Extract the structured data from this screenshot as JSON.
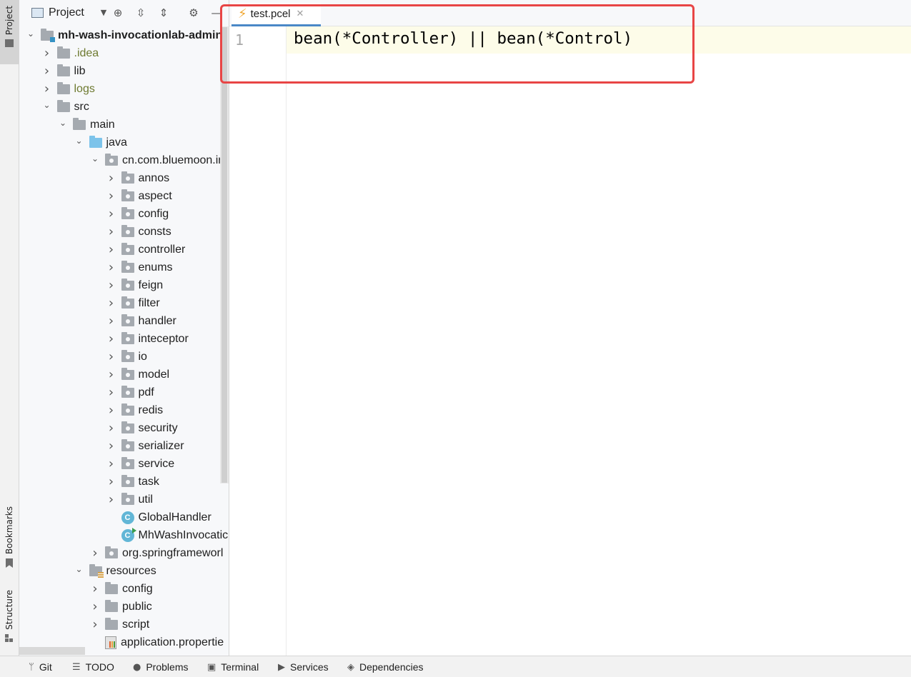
{
  "left_strip": {
    "project_label": "Project",
    "bookmarks_label": "Bookmarks",
    "structure_label": "Structure"
  },
  "project_panel": {
    "title": "Project",
    "tree": [
      {
        "label": "mh-wash-invocationlab-admin",
        "depth": 0,
        "expanded": true,
        "icon": "module-folder-icon",
        "bold": true
      },
      {
        "label": ".idea",
        "depth": 1,
        "expanded": false,
        "icon": "folder-icon",
        "style": "excluded"
      },
      {
        "label": "lib",
        "depth": 1,
        "expanded": false,
        "icon": "folder-icon"
      },
      {
        "label": "logs",
        "depth": 1,
        "expanded": false,
        "icon": "folder-icon",
        "style": "excluded"
      },
      {
        "label": "src",
        "depth": 1,
        "expanded": true,
        "icon": "folder-icon"
      },
      {
        "label": "main",
        "depth": 2,
        "expanded": true,
        "icon": "folder-icon"
      },
      {
        "label": "java",
        "depth": 3,
        "expanded": true,
        "icon": "source-folder-icon"
      },
      {
        "label": "cn.com.bluemoon.in",
        "depth": 4,
        "expanded": true,
        "icon": "package-icon"
      },
      {
        "label": "annos",
        "depth": 5,
        "expanded": false,
        "icon": "package-icon"
      },
      {
        "label": "aspect",
        "depth": 5,
        "expanded": false,
        "icon": "package-icon"
      },
      {
        "label": "config",
        "depth": 5,
        "expanded": false,
        "icon": "package-icon"
      },
      {
        "label": "consts",
        "depth": 5,
        "expanded": false,
        "icon": "package-icon"
      },
      {
        "label": "controller",
        "depth": 5,
        "expanded": false,
        "icon": "package-icon"
      },
      {
        "label": "enums",
        "depth": 5,
        "expanded": false,
        "icon": "package-icon"
      },
      {
        "label": "feign",
        "depth": 5,
        "expanded": false,
        "icon": "package-icon"
      },
      {
        "label": "filter",
        "depth": 5,
        "expanded": false,
        "icon": "package-icon"
      },
      {
        "label": "handler",
        "depth": 5,
        "expanded": false,
        "icon": "package-icon"
      },
      {
        "label": "inteceptor",
        "depth": 5,
        "expanded": false,
        "icon": "package-icon"
      },
      {
        "label": "io",
        "depth": 5,
        "expanded": false,
        "icon": "package-icon"
      },
      {
        "label": "model",
        "depth": 5,
        "expanded": false,
        "icon": "package-icon"
      },
      {
        "label": "pdf",
        "depth": 5,
        "expanded": false,
        "icon": "package-icon"
      },
      {
        "label": "redis",
        "depth": 5,
        "expanded": false,
        "icon": "package-icon"
      },
      {
        "label": "security",
        "depth": 5,
        "expanded": false,
        "icon": "package-icon"
      },
      {
        "label": "serializer",
        "depth": 5,
        "expanded": false,
        "icon": "package-icon"
      },
      {
        "label": "service",
        "depth": 5,
        "expanded": false,
        "icon": "package-icon"
      },
      {
        "label": "task",
        "depth": 5,
        "expanded": false,
        "icon": "package-icon"
      },
      {
        "label": "util",
        "depth": 5,
        "expanded": false,
        "icon": "package-icon"
      },
      {
        "label": "GlobalHandler",
        "depth": 5,
        "expanded": null,
        "icon": "class-icon"
      },
      {
        "label": "MhWashInvocatic",
        "depth": 5,
        "expanded": null,
        "icon": "runnable-class-icon"
      },
      {
        "label": "org.springframeworl",
        "depth": 4,
        "expanded": false,
        "icon": "package-icon"
      },
      {
        "label": "resources",
        "depth": 3,
        "expanded": true,
        "icon": "resources-folder-icon"
      },
      {
        "label": "config",
        "depth": 4,
        "expanded": false,
        "icon": "folder-icon"
      },
      {
        "label": "public",
        "depth": 4,
        "expanded": false,
        "icon": "folder-icon"
      },
      {
        "label": "script",
        "depth": 4,
        "expanded": false,
        "icon": "folder-icon"
      },
      {
        "label": "application.propertie",
        "depth": 4,
        "expanded": null,
        "icon": "properties-file-icon"
      }
    ]
  },
  "editor": {
    "tab_label": "test.pcel",
    "tab_icon": "lightning-icon",
    "line_number": "1",
    "code": "bean(*Controller) || bean(*Control)",
    "highlight_color": "#e84545"
  },
  "bottom_bar": {
    "tools": [
      {
        "label": "Git",
        "icon": "git-branch-icon"
      },
      {
        "label": "TODO",
        "icon": "list-icon"
      },
      {
        "label": "Problems",
        "icon": "problems-icon"
      },
      {
        "label": "Terminal",
        "icon": "terminal-icon"
      },
      {
        "label": "Services",
        "icon": "services-icon"
      },
      {
        "label": "Dependencies",
        "icon": "layers-icon"
      }
    ]
  },
  "colors": {
    "accent": "#4a88c7",
    "current_line": "#fdfce9",
    "excluded_folder_text": "#6e7a30",
    "bolt": "#f0a732"
  }
}
